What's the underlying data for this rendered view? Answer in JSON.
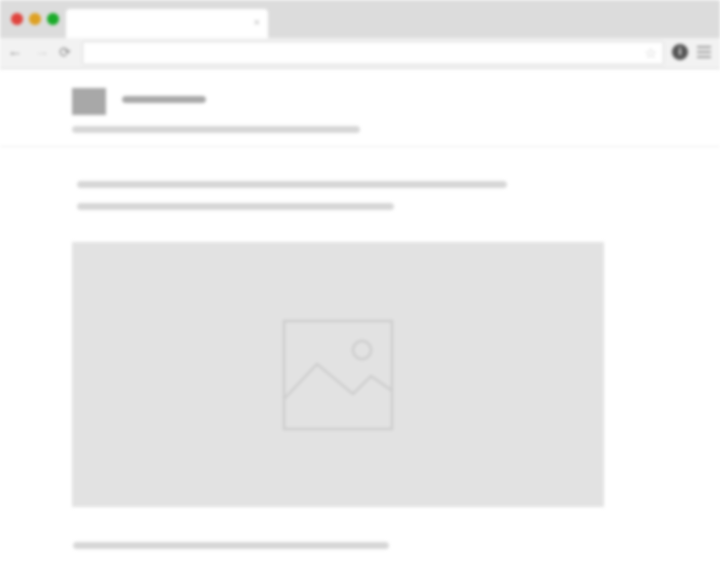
{
  "browser": {
    "traffic_lights": {
      "close": "#e0443e",
      "minimize": "#dea123",
      "maximize": "#1aab29"
    },
    "tab": {
      "title": "",
      "close_glyph": "×"
    },
    "toolbar": {
      "back_glyph": "←",
      "forward_glyph": "→",
      "reload_glyph": "⟳",
      "address": "",
      "bookmark_glyph": "☆",
      "info_glyph": "i"
    }
  },
  "page": {
    "logo": {
      "icon": "logo-placeholder",
      "color": "#a8a8a8"
    },
    "site_title_placeholder_color": "#a8a8a8",
    "text_placeholder_color": "#d6d6d6",
    "hero_image": {
      "icon": "image-placeholder-icon",
      "background": "#e2e2e2",
      "stroke": "#c8c8c8"
    }
  }
}
